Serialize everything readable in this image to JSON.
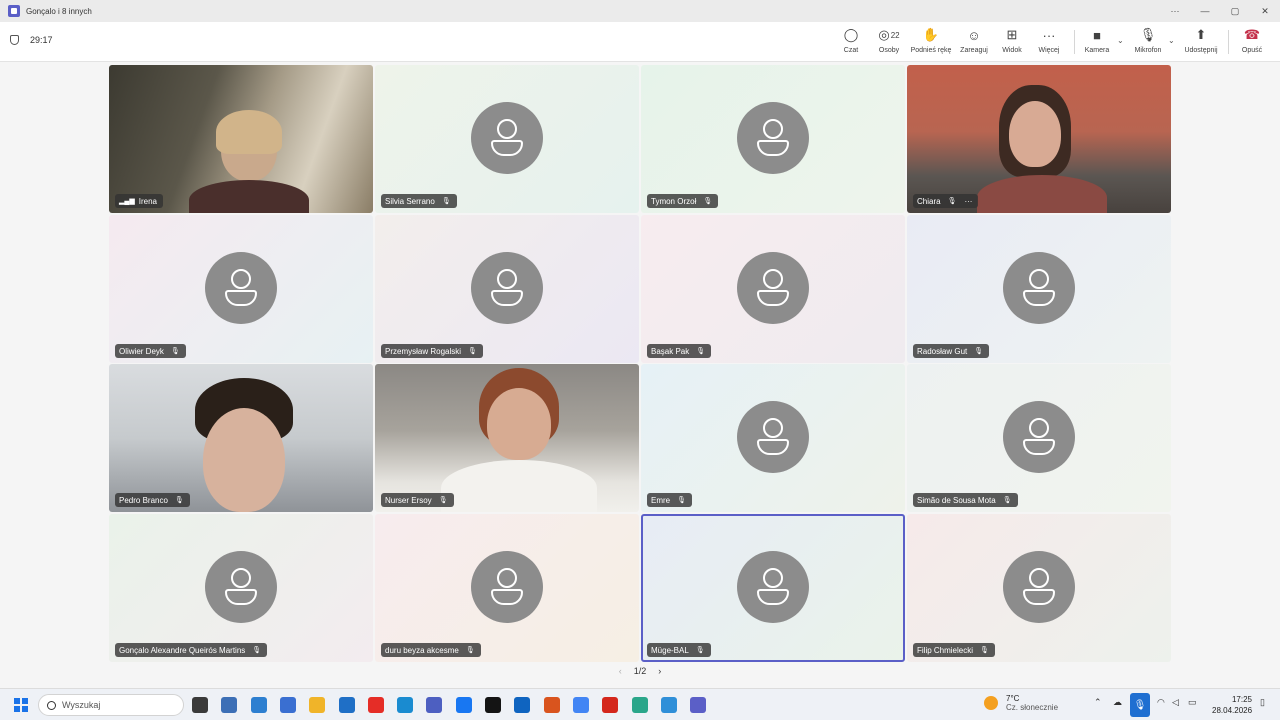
{
  "window": {
    "title": "Gonçalo i 8 innych",
    "controls": [
      "···",
      "—",
      "▢",
      "✕"
    ]
  },
  "meeting": {
    "timer": "29:17",
    "toolbar": [
      {
        "label": "Czat",
        "icon": "chat-icon",
        "glyph": "◯"
      },
      {
        "label": "Osoby",
        "icon": "people-icon",
        "glyph": "◎",
        "count": "22"
      },
      {
        "label": "Podnieś rękę",
        "icon": "raise-hand-icon",
        "glyph": "✋"
      },
      {
        "label": "Zareaguj",
        "icon": "react-icon",
        "glyph": "☺"
      },
      {
        "label": "Widok",
        "icon": "view-icon",
        "glyph": "⊞"
      },
      {
        "label": "Więcej",
        "icon": "more-icon",
        "glyph": "···"
      },
      {
        "label": "Kamera",
        "icon": "camera-icon",
        "glyph": "■"
      },
      {
        "label": "Mikrofon",
        "icon": "microphone-icon",
        "glyph": "🎙"
      },
      {
        "label": "Udostępnij",
        "icon": "share-icon",
        "glyph": "⬆"
      },
      {
        "label": "Opuść",
        "icon": "hang-up-icon",
        "glyph": "☎",
        "color": "#c4314b"
      }
    ]
  },
  "participants": [
    {
      "name": "Irena",
      "video": true,
      "muted": false
    },
    {
      "name": "Silvia Serrano",
      "video": false,
      "muted": true,
      "tint": [
        "#eef3ea",
        "#e6f2ee"
      ]
    },
    {
      "name": "Tymon Orzoł",
      "video": false,
      "muted": true,
      "tint": [
        "#e6f3ea",
        "#eef4ec"
      ]
    },
    {
      "name": "Chiara",
      "video": true,
      "muted": true
    },
    {
      "name": "Oliwier Deyk",
      "video": false,
      "muted": true,
      "tint": [
        "#f5eaf0",
        "#e7f1f3"
      ]
    },
    {
      "name": "Przemysław Rogalski",
      "video": false,
      "muted": true,
      "tint": [
        "#f3eeec",
        "#ebe8f3"
      ]
    },
    {
      "name": "Başak Pak",
      "video": false,
      "muted": true,
      "tint": [
        "#f7ecef",
        "#efebef"
      ]
    },
    {
      "name": "Radosław Gut",
      "video": false,
      "muted": true,
      "tint": [
        "#e9ebf4",
        "#eef3f2"
      ]
    },
    {
      "name": "Pedro Branco",
      "video": true,
      "muted": true
    },
    {
      "name": "Nurser Ersoy",
      "video": true,
      "muted": true
    },
    {
      "name": "Emre",
      "video": false,
      "muted": true,
      "tint": [
        "#e6f1f6",
        "#eef2ea"
      ]
    },
    {
      "name": "Simão de Sousa Mota",
      "video": false,
      "muted": true,
      "tint": [
        "#edf1f1",
        "#f1f4ee"
      ]
    },
    {
      "name": "Gonçalo Alexandre Queirós Martins",
      "video": false,
      "muted": true,
      "tint": [
        "#eaf2ea",
        "#f3ecef"
      ]
    },
    {
      "name": "duru beyza akcesme",
      "video": false,
      "muted": true,
      "tint": [
        "#f7ecee",
        "#f6efe4"
      ]
    },
    {
      "name": "Müge-BAL",
      "video": false,
      "muted": true,
      "selected": true,
      "tint": [
        "#e7ecf5",
        "#eaf3ea"
      ]
    },
    {
      "name": "Filip Chmielecki",
      "video": false,
      "muted": true,
      "tint": [
        "#f6eaea",
        "#edf1ec"
      ]
    }
  ],
  "pager": {
    "label": "1/2",
    "prev": "‹",
    "next": "›"
  },
  "taskbar": {
    "search_placeholder": "Wyszukaj",
    "apps": [
      {
        "icon": "file-explorer-dark-icon",
        "color": "#3a3a3a"
      },
      {
        "icon": "snipping-tool-icon",
        "color": "#3c6fb6"
      },
      {
        "icon": "calculator-icon",
        "color": "#2d7fd0"
      },
      {
        "icon": "store-icon",
        "color": "#3a6fd1"
      },
      {
        "icon": "folder-icon",
        "color": "#f0b429"
      },
      {
        "icon": "outlook-icon",
        "color": "#1f6fc6"
      },
      {
        "icon": "youtube-icon",
        "color": "#e52d27"
      },
      {
        "icon": "edge-icon",
        "color": "#1a8bd0"
      },
      {
        "icon": "app-icon",
        "color": "#4d5fc1"
      },
      {
        "icon": "facebook-icon",
        "color": "#1877f2"
      },
      {
        "icon": "netflix-icon",
        "color": "#141414"
      },
      {
        "icon": "outlook-mail-icon",
        "color": "#0f64c0"
      },
      {
        "icon": "mail-icon",
        "color": "#d9541e"
      },
      {
        "icon": "chrome-icon",
        "color": "#4285f4"
      },
      {
        "icon": "acrobat-icon",
        "color": "#d4271c"
      },
      {
        "icon": "maps-icon",
        "color": "#2aa68a"
      },
      {
        "icon": "notepad-icon",
        "color": "#2f8fd8"
      },
      {
        "icon": "teams-icon",
        "color": "#5b5fc7"
      }
    ],
    "weather_temp": "7°C",
    "weather_desc": "Cz. słonecznie",
    "time": "17:25",
    "date": "28.04.2026"
  }
}
